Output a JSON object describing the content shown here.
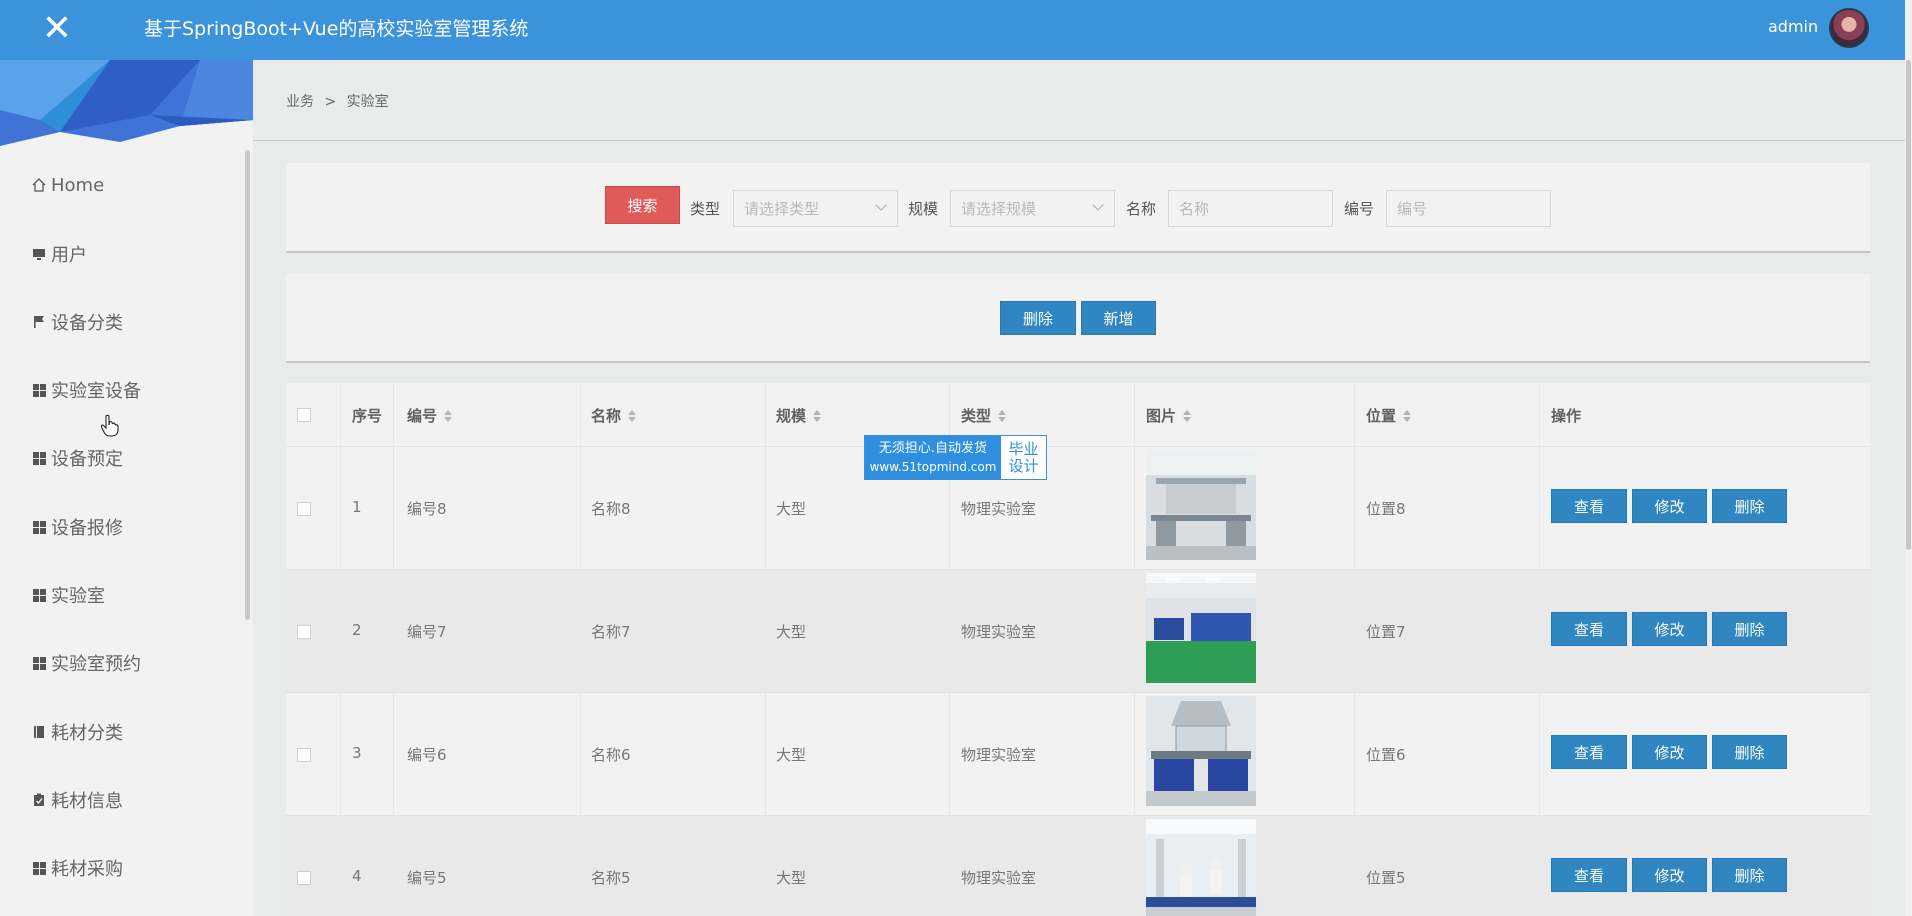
{
  "header": {
    "close_icon": "close-icon",
    "title": "基于SpringBoot+Vue的高校实验室管理系统",
    "username": "admin"
  },
  "sidebar": {
    "items": [
      {
        "label": "Home",
        "icon": "home-icon"
      },
      {
        "label": "用户",
        "icon": "monitor-icon"
      },
      {
        "label": "设备分类",
        "icon": "flag-icon"
      },
      {
        "label": "实验室设备",
        "icon": "grid-icon"
      },
      {
        "label": "设备预定",
        "icon": "grid-icon"
      },
      {
        "label": "设备报修",
        "icon": "grid-icon"
      },
      {
        "label": "实验室",
        "icon": "grid-icon"
      },
      {
        "label": "实验室预约",
        "icon": "grid-icon"
      },
      {
        "label": "耗材分类",
        "icon": "book-icon"
      },
      {
        "label": "耗材信息",
        "icon": "clipboard-icon"
      },
      {
        "label": "耗材采购",
        "icon": "grid-icon"
      }
    ]
  },
  "breadcrumb": {
    "parent": "业务",
    "separator": ">",
    "current": "实验室"
  },
  "search": {
    "button": "搜索",
    "type_label": "类型",
    "type_placeholder": "请选择类型",
    "scale_label": "规模",
    "scale_placeholder": "请选择规模",
    "name_label": "名称",
    "name_placeholder": "名称",
    "code_label": "编号",
    "code_placeholder": "编号"
  },
  "actions": {
    "delete": "删除",
    "add": "新增"
  },
  "table": {
    "columns": [
      "序号",
      "编号",
      "名称",
      "规模",
      "类型",
      "图片",
      "位置",
      "操作"
    ],
    "rows": [
      {
        "index": "1",
        "code": "编号8",
        "name": "名称8",
        "scale": "大型",
        "type": "物理实验室",
        "location": "位置8"
      },
      {
        "index": "2",
        "code": "编号7",
        "name": "名称7",
        "scale": "大型",
        "type": "物理实验室",
        "location": "位置7"
      },
      {
        "index": "3",
        "code": "编号6",
        "name": "名称6",
        "scale": "大型",
        "type": "物理实验室",
        "location": "位置6"
      },
      {
        "index": "4",
        "code": "编号5",
        "name": "名称5",
        "scale": "大型",
        "type": "物理实验室",
        "location": "位置5"
      }
    ],
    "row_actions": {
      "view": "查看",
      "edit": "修改",
      "delete": "删除"
    }
  },
  "watermark": {
    "line1": "无须担心.自动发货",
    "line2": "www.51topmind.com",
    "right1": "毕业",
    "right2": "设计"
  },
  "colors": {
    "header": "#3b93dc",
    "search_button": "#e05a5a",
    "action_button": "#2f86c0"
  }
}
